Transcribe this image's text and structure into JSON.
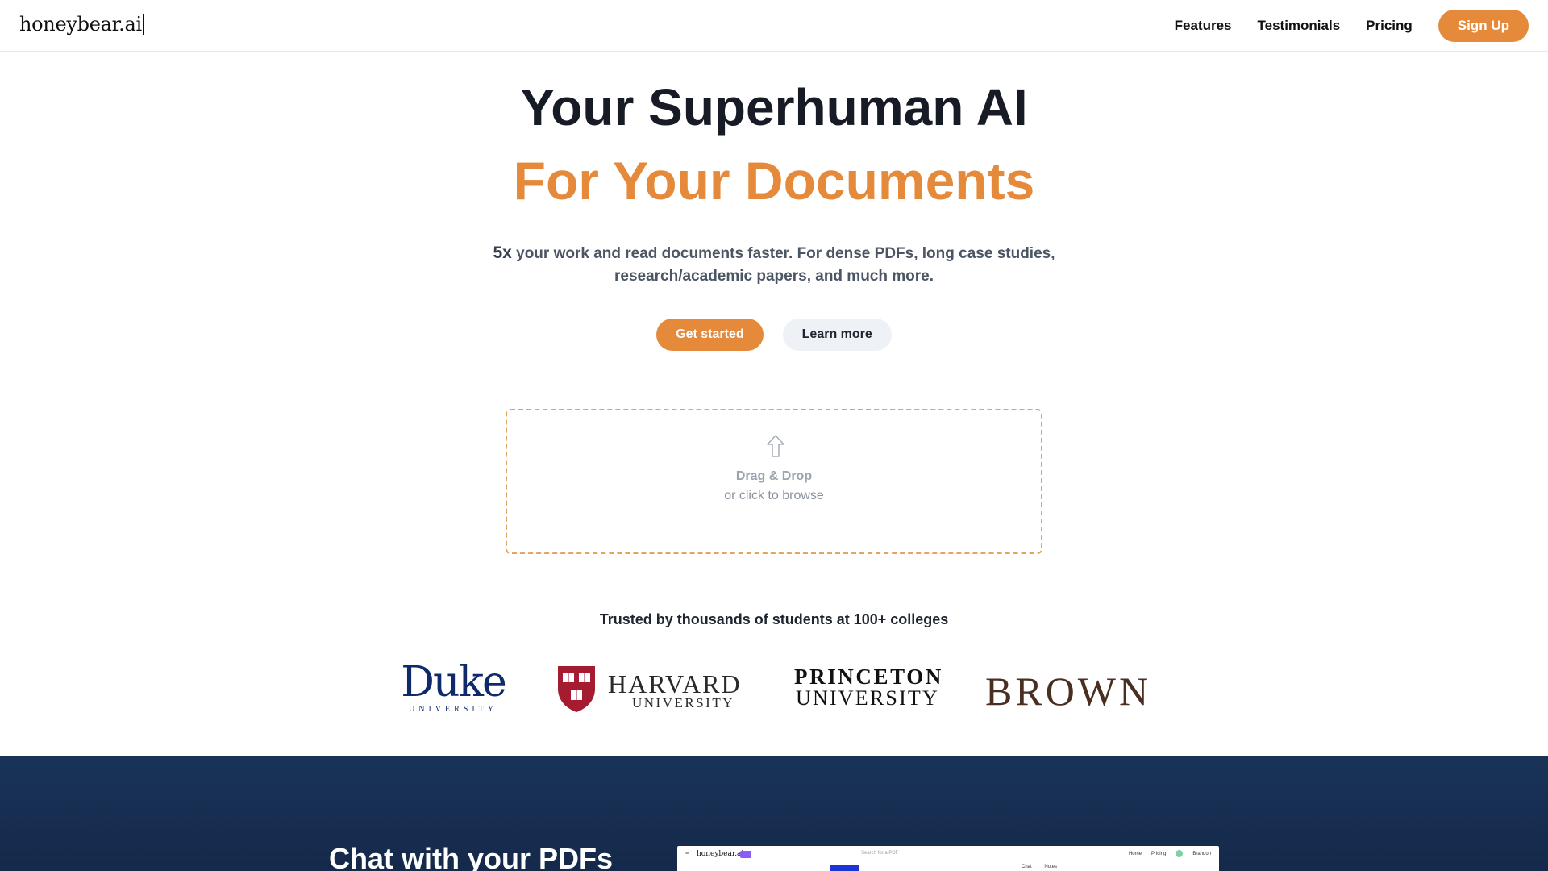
{
  "header": {
    "logo": "honeybear.ai",
    "nav": [
      "Features",
      "Testimonials",
      "Pricing"
    ],
    "signup_label": "Sign Up"
  },
  "hero": {
    "title_line1": "Your Superhuman AI",
    "title_line2": "For Your Documents",
    "subtitle_multiplier": "5x",
    "subtitle_text": " your work and read documents faster. For dense PDFs, long case studies, research/academic papers, and much more.",
    "primary_cta": "Get started",
    "secondary_cta": "Learn more"
  },
  "dropzone": {
    "icon": "upload-arrow-icon",
    "title": "Drag & Drop",
    "subtitle": "or click to browse"
  },
  "trusted": {
    "text": "Trusted by thousands of students at 100+ colleges",
    "logos": {
      "duke_name": "Duke",
      "duke_sub": "UNIVERSITY",
      "harvard_name": "HARVARD",
      "harvard_sub": "UNIVERSITY",
      "princeton_name": "PRINCETON",
      "princeton_sub": "UNIVERSITY",
      "brown_name": "BROWN"
    }
  },
  "feature_section": {
    "title": "Chat with your PDFs",
    "preview": {
      "menu_glyph": "≡",
      "logo": "honeybear.ai",
      "search_placeholder": "Search for a PDF",
      "nav": [
        "Home",
        "Pricing"
      ],
      "user": "Brandon",
      "tabs": [
        "Chat",
        "Notes"
      ]
    }
  },
  "colors": {
    "accent": "#e5893a",
    "heading": "#161b26",
    "dark_section": "#193359",
    "duke_blue": "#0f2a6b",
    "harvard_crimson": "#a51c30",
    "brown": "#4a2e20"
  }
}
